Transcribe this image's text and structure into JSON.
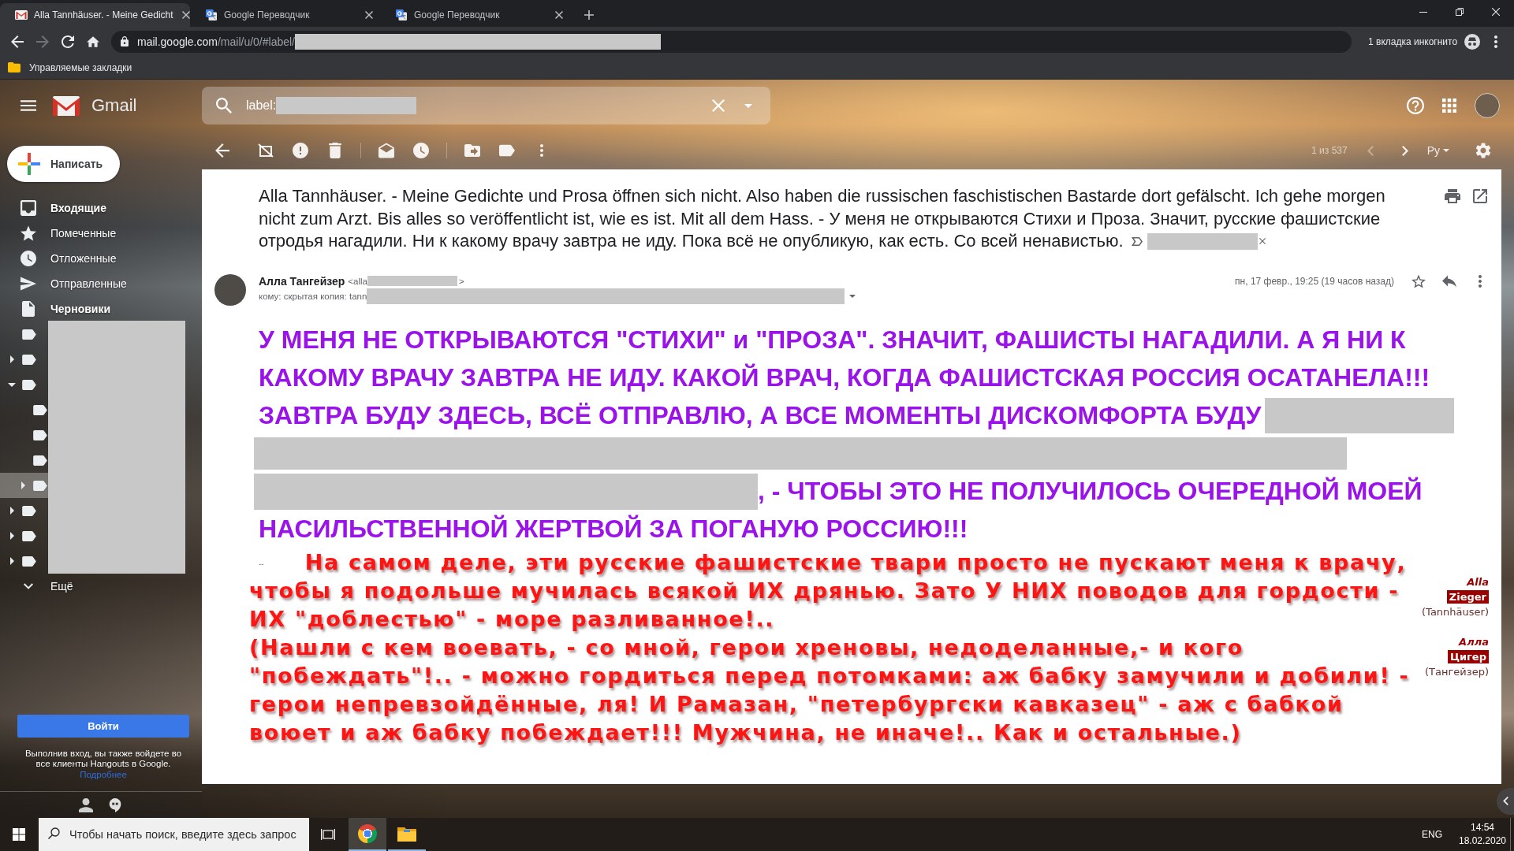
{
  "browser": {
    "tabs": [
      {
        "kind": "mail",
        "title": "Alla Tannhäuser. - Meine Gedicht",
        "selected": true
      },
      {
        "kind": "translate",
        "title": "Google Переводчик",
        "selected": false
      },
      {
        "kind": "translate",
        "title": "Google Переводчик",
        "selected": false
      }
    ],
    "nav": {
      "forward_disabled": true
    },
    "address": {
      "host": "mail.google.com",
      "path": "/mail/u/0/#label/",
      "tail_redacted": true
    },
    "incognito": "1 вкладка инкогнито",
    "bookmarks": [
      "Управляемые закладки"
    ]
  },
  "gmail": {
    "app_name": "Gmail",
    "search": {
      "value": "label:",
      "tail_redacted": true
    },
    "compose": "Написать",
    "folders": [
      {
        "kind": "inbox",
        "label": "Входящие",
        "unread": true,
        "selected": false
      },
      {
        "kind": "starred",
        "label": "Помеченные",
        "unread": false,
        "selected": false
      },
      {
        "kind": "snoozed",
        "label": "Отложенные",
        "unread": false,
        "selected": false
      },
      {
        "kind": "sent",
        "label": "Отправленные",
        "unread": false,
        "selected": false
      },
      {
        "kind": "drafts",
        "label": "Черновики",
        "unread": true,
        "selected": false
      }
    ],
    "labels": [
      {
        "selected": false
      },
      {
        "expanded": false,
        "selected": false
      },
      {
        "expanded": true,
        "selected": false,
        "children": [
          {
            "selected": false
          },
          {
            "selected": false
          },
          {
            "selected": false
          },
          {
            "expanded": false,
            "selected": true
          }
        ]
      },
      {
        "expanded": false,
        "selected": false
      },
      {
        "expanded": false,
        "selected": false
      },
      {
        "expanded": false,
        "selected": false
      }
    ],
    "label_names_redacted": true,
    "more": "Ещё",
    "hangouts": {
      "sign_in": "Войти",
      "note": "Выполнив вход, вы также войдете во все клиенты Hangouts в Google.",
      "link": "Подробнее"
    },
    "toolbar": {
      "counter": "1 из 537",
      "prev_disabled": true,
      "next_disabled": false,
      "input_tool": "Ру"
    },
    "message": {
      "subject_lines": [
        "Alla Tannhäuser. - Meine Gedichte und Prosa öffnen sich nicht. Also haben die russischen faschistischen Bastarde dort gefälscht. Ich gehe morgen",
        "nicht zum Arzt. Bis alles so veröffentlicht ist, wie es ist. Mit all dem Hass. - У меня не открываются Стихи и Проза. Значит, русские фашистские",
        "отродья нагадили. Ни к какому врачу завтра не иду. Пока всё не опубликую, как есть. Со всей ненавистью."
      ],
      "important": false,
      "chips": [
        {
          "kind": "redaction"
        }
      ],
      "sender": {
        "name": "Алла Тангейзер",
        "address_start": "<alla",
        "address_redacted": true,
        "address_end": ">"
      },
      "recipients": {
        "text": "кому: скрытая копия: tann",
        "tail_redacted": true
      },
      "date": "пн, 17 февр., 19:25 (19 часов назад)",
      "starred": false,
      "body_lines": [
        [
          {
            "kind": "text",
            "text": "У МЕНЯ НЕ ОТКРЫВАЮТСЯ \"СТИХИ\" и \"ПРОЗА\". ЗНАЧИТ, ФАШИСТЫ НАГАДИЛИ. А Я НИ К"
          }
        ],
        [
          {
            "kind": "text",
            "text": "КАКОМУ ВРАЧУ ЗАВТРА НЕ ИДУ. КАКОЙ ВРАЧ, КОГДА ФАШИСТСКАЯ РОССИЯ ОСАТАНЕЛА!!!"
          }
        ],
        [
          {
            "kind": "text",
            "text": "ЗАВТРА БУДУ ЗДЕСЬ, ВСЁ ОТПРАВЛЮ, А ВСЕ МОМЕНТЫ ДИСКОМФОРТА БУДУ"
          },
          {
            "kind": "redaction"
          }
        ],
        [
          {
            "kind": "redaction"
          }
        ],
        [
          {
            "kind": "redaction"
          },
          {
            "kind": "text",
            "text": ", - ЧТОБЫ ЭТО НЕ ПОЛУЧИЛОСЬ ОЧЕРЕДНОЙ МОЕЙ"
          }
        ],
        [
          {
            "kind": "text",
            "text": "НАСИЛЬСТВЕННОЙ ЖЕРТВОЙ ЗА ПОГАНУЮ РОССИЮ!!!"
          }
        ]
      ],
      "signature_separator": "--",
      "image_text": [
        "На самом деле, эти русские фашистские твари просто не пускают меня к врачу,",
        "чтобы я подольше мучилась всякой ИХ дрянью. Зато У НИХ поводов для гордости -",
        "ИХ \"доблестью\" - море разливанное!..",
        "(Нашли с кем воевать, - со мной, герои хреновы, недоделанные,- и кого",
        "\"побеждать\"!.. - можно гордиться перед потомками: аж бабку замучили и добили! -",
        "герои непревзойдённые, ля! И Рамазан, \"петербургски кавказец\" - аж с бабкой",
        "воюет и аж бабку побеждает!!! Мужчина, не иначе!.. Как и остальные.)"
      ],
      "signature": [
        {
          "first": "Alla",
          "last": "Zieger",
          "alias": "(Tannhäuser)"
        },
        {
          "first": "Алла",
          "last": "Цигер",
          "alias": "(Тангейзер)"
        }
      ]
    }
  },
  "taskbar": {
    "search_placeholder": "Чтобы начать поиск, введите здесь запрос",
    "apps": [
      {
        "kind": "browser",
        "active": true
      },
      {
        "kind": "files",
        "active": false
      }
    ],
    "language": "ENG",
    "time": "14:54",
    "date": "18.02.2020"
  }
}
